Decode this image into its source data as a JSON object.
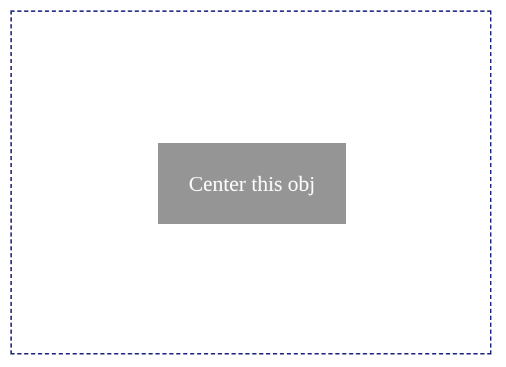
{
  "container": {
    "border_color": "#1a237e",
    "background": "#ffffff"
  },
  "centered_box": {
    "label": "Center this obj",
    "background": "#959595",
    "text_color": "#ffffff"
  }
}
